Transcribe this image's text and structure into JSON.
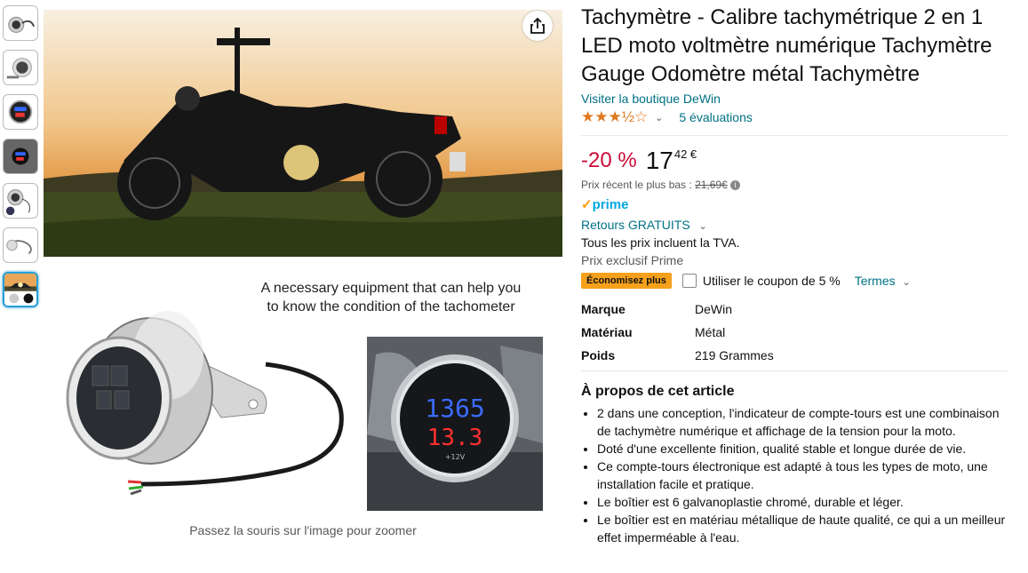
{
  "thumbnails": [
    {
      "name": "thumbnail-gauge-chrome"
    },
    {
      "name": "thumbnail-gauge-front"
    },
    {
      "name": "thumbnail-gauge-display"
    },
    {
      "name": "thumbnail-gauge-lit"
    },
    {
      "name": "thumbnail-gauge-wired"
    },
    {
      "name": "thumbnail-gauge-cable"
    },
    {
      "name": "thumbnail-motorcycle-sunset"
    }
  ],
  "gallery": {
    "caption_line1": "A necessary equipment that can help you",
    "caption_line2": "to know the condition of the tachometer",
    "rpm_reading": "1365",
    "voltage_reading": "13.3",
    "volt_label": "+12V",
    "hover_hint": "Passez la souris sur l'image pour zoomer"
  },
  "product": {
    "title": "Tachymètre - Calibre tachymétrique 2 en 1 LED moto voltmètre numérique Tachymètre Gauge Odomètre métal Tachymètre",
    "store_link": "Visiter la boutique DeWin",
    "rating_stars": "★★★½☆",
    "rating_value": 3.5,
    "rating_count": "5 évaluations",
    "discount": "-20 %",
    "price_whole": "17",
    "price_fraction": "42 €",
    "low_price_label": "Prix récent le plus bas :",
    "low_price_value": "21,69€",
    "prime_label": "prime",
    "returns": "Retours GRATUITS",
    "vat_note": "Tous les prix incluent la TVA.",
    "prime_exclusive": "Prix exclusif Prime",
    "savings_badge": "Économisez plus",
    "coupon_label": "Utiliser le coupon de 5 %",
    "terms_label": "Termes"
  },
  "specs": [
    {
      "key": "Marque",
      "value": "DeWin"
    },
    {
      "key": "Matériau",
      "value": "Métal"
    },
    {
      "key": "Poids",
      "value": "219 Grammes"
    }
  ],
  "about": {
    "title": "À propos de cet article",
    "bullets": [
      "2 dans une conception, l'indicateur de compte-tours est une combinaison de tachymètre numérique et affichage de la tension pour la moto.",
      "Doté d'une excellente finition, qualité stable et longue durée de vie.",
      "Ce compte-tours électronique est adapté à tous les types de moto, une installation facile et pratique.",
      "Le boîtier est 6 galvanoplastie chromé, durable et léger.",
      "Le boîtier est en matériau métallique de haute qualité, ce qui a un meilleur effet imperméable à l'eau."
    ]
  },
  "colors": {
    "link": "#007185",
    "discount": "#cc0c39",
    "star": "#de7921",
    "prime": "#00a8e1",
    "badge": "#f6a11c"
  }
}
